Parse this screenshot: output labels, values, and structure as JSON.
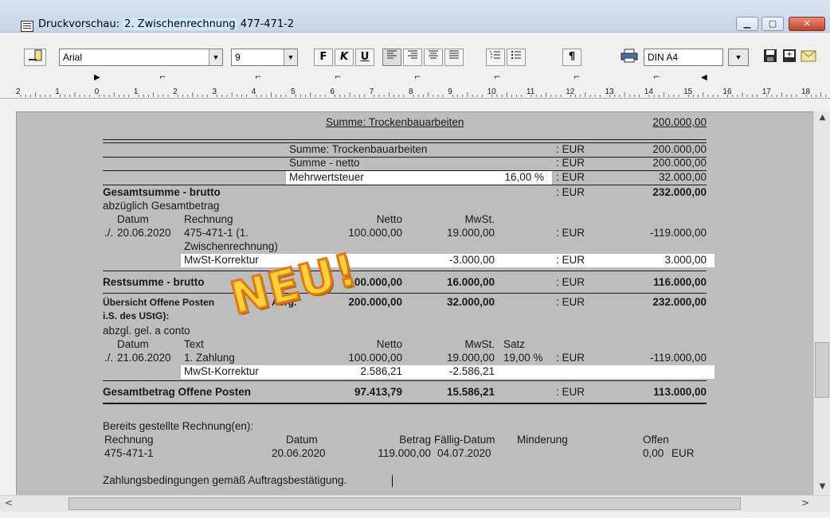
{
  "window": {
    "title_prefix": "Druckvorschau: ",
    "title_highlight": "2. Zwischenrechnung",
    "title_suffix": " 477-471-2",
    "minimize": "▁",
    "maximize": "▢",
    "close": "✕"
  },
  "toolbar": {
    "font": "Arial",
    "size": "9",
    "bold": "F",
    "italic": "K",
    "underline": "U",
    "paragraph": "¶",
    "paper": "DIN A4",
    "dropdown_arrow": "▼"
  },
  "ruler": {
    "labels": [
      "2",
      "1",
      "0",
      "1",
      "2",
      "3",
      "4",
      "5",
      "6",
      "7",
      "8",
      "9",
      "10",
      "11",
      "12",
      "13",
      "14",
      "15",
      "16",
      "17",
      "18"
    ]
  },
  "doc": {
    "summe_top_label": "Summe: Trockenbauarbeiten",
    "summe_top_value": "200.000,00",
    "rows_summary": [
      {
        "label": "Summe: Trockenbauarbeiten",
        "pct": "",
        "cur": ": EUR",
        "value": "200.000,00"
      },
      {
        "label": "Summe - netto",
        "pct": "",
        "cur": ": EUR",
        "value": "200.000,00"
      },
      {
        "label": "Mehrwertsteuer",
        "pct": "16,00 %",
        "cur": ": EUR",
        "value": "32.000,00"
      }
    ],
    "gesamtsumme_label": "Gesamtsumme - brutto",
    "gesamtsumme_cur": ": EUR",
    "gesamtsumme_value": "232.000,00",
    "abzueglich": "abzüglich Gesamtbetrag",
    "hdr_datum": "Datum",
    "hdr_rechnung": "Rechnung",
    "hdr_netto": "Netto",
    "hdr_mwst": "MwSt.",
    "r1_prefix": "./.",
    "r1_datum": "20.06.2020",
    "r1_rechnung": "475-471-1 (1.",
    "r1_rechnung2": "Zwischenrechnung)",
    "r1_netto": "100.000,00",
    "r1_mwst": "19.000,00",
    "r1_cur": ": EUR",
    "r1_value": "-119.000,00",
    "korr1_label": "MwSt-Korrektur",
    "korr1_mwst": "-3.000,00",
    "korr1_cur": ": EUR",
    "korr1_value": "3.000,00",
    "rest_label": "Restsumme - brutto",
    "rest_netto": "100.000,00",
    "rest_mwst": "16.000,00",
    "rest_cur": ": EUR",
    "rest_value": "116.000,00",
    "op_label1": "Übersicht Offene Posten",
    "op_label1b": "Abrg.",
    "op_label2": "i.S. des UStG):",
    "op_netto": "200.000,00",
    "op_mwst": "32.000,00",
    "op_cur": ": EUR",
    "op_value": "232.000,00",
    "abzgl": "abzgl. gel. a conto",
    "hdr2_datum": "Datum",
    "hdr2_text": "Text",
    "hdr2_netto": "Netto",
    "hdr2_mwst": "MwSt.",
    "hdr2_satz": "Satz",
    "z_prefix": "./.",
    "z_datum": "21.06.2020",
    "z_text": "1. Zahlung",
    "z_netto": "100.000,00",
    "z_mwst": "19.000,00",
    "z_satz": "19,00 %",
    "z_cur": ": EUR",
    "z_value": "-119.000,00",
    "korr2_label": "MwSt-Korrektur",
    "korr2_netto": "2.586,21",
    "korr2_mwst": "-2.586,21",
    "gop_label": "Gesamtbetrag Offene Posten",
    "gop_netto": "97.413,79",
    "gop_mwst": "15.586,21",
    "gop_cur": ": EUR",
    "gop_value": "113.000,00",
    "bereits": "Bereits gestellte Rechnung(en):",
    "bh_rechnung": "Rechnung",
    "bh_datum": "Datum",
    "bh_betrag": "Betrag",
    "bh_faellig": "Fällig-Datum",
    "bh_minderung": "Minderung",
    "bh_offen": "Offen",
    "b_rechnung": "475-471-1",
    "b_datum": "20.06.2020",
    "b_betrag": "119.000,00",
    "b_faellig": "04.07.2020",
    "b_offen": "0,00",
    "b_cur": "EUR",
    "zahlung": "Zahlungsbedingungen gemäß Auftragsbestätigung.",
    "stamp": "NEU!"
  },
  "scroll": {
    "up": "▲",
    "down": "▼",
    "left": "<",
    "right": ">"
  }
}
